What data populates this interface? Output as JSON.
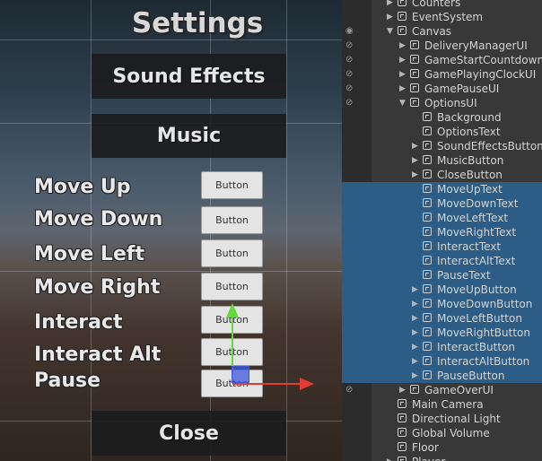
{
  "scene": {
    "title": "Settings",
    "buttons": {
      "sound_effects": "Sound Effects",
      "music": "Music",
      "close": "Close"
    },
    "labels": [
      "Move Up",
      "Move Down",
      "Move Left",
      "Move Right",
      "Interact",
      "Interact Alt",
      "Pause"
    ],
    "key_button_label": "Button"
  },
  "hierarchy": {
    "items": [
      {
        "label": "Counters"
      },
      {
        "label": "EventSystem"
      },
      {
        "label": "Canvas"
      },
      {
        "label": "DeliveryManagerUI"
      },
      {
        "label": "GameStartCountdownUI"
      },
      {
        "label": "GamePlayingClockUI"
      },
      {
        "label": "GamePauseUI"
      },
      {
        "label": "OptionsUI"
      },
      {
        "label": "Background"
      },
      {
        "label": "OptionsText"
      },
      {
        "label": "SoundEffectsButton"
      },
      {
        "label": "MusicButton"
      },
      {
        "label": "CloseButton"
      },
      {
        "label": "MoveUpText"
      },
      {
        "label": "MoveDownText"
      },
      {
        "label": "MoveLeftText"
      },
      {
        "label": "MoveRightText"
      },
      {
        "label": "InteractText"
      },
      {
        "label": "InteractAltText"
      },
      {
        "label": "PauseText"
      },
      {
        "label": "MoveUpButton"
      },
      {
        "label": "MoveDownButton"
      },
      {
        "label": "MoveLeftButton"
      },
      {
        "label": "MoveRightButton"
      },
      {
        "label": "InteractButton"
      },
      {
        "label": "InteractAltButton"
      },
      {
        "label": "PauseButton"
      },
      {
        "label": "GameOverUI"
      },
      {
        "label": "Main Camera"
      },
      {
        "label": "Directional Light"
      },
      {
        "label": "Global Volume"
      },
      {
        "label": "Floor"
      },
      {
        "label": "Player"
      }
    ]
  },
  "colors": {
    "selection": "#2c5d87",
    "panel": "#383838",
    "gizmo_x": "#e23c33",
    "gizmo_y": "#5fdc3a"
  }
}
